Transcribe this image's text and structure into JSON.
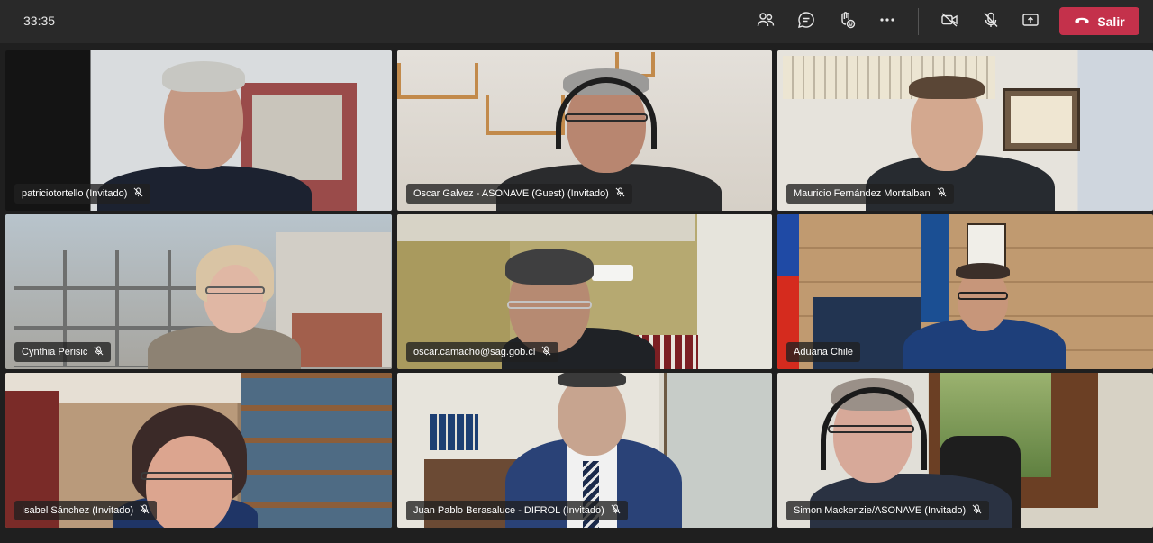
{
  "meeting": {
    "timer": "33:35",
    "leave_label": "Salir"
  },
  "controls": [
    {
      "name": "participants-icon"
    },
    {
      "name": "chat-icon"
    },
    {
      "name": "reactions-icon"
    },
    {
      "name": "more-options-icon"
    },
    {
      "name": "camera-off-icon"
    },
    {
      "name": "mic-muted-icon"
    },
    {
      "name": "share-screen-icon"
    }
  ],
  "participants": [
    {
      "name": "patriciotortello (Invitado)",
      "muted": true
    },
    {
      "name": "Oscar Galvez - ASONAVE (Guest) (Invitado)",
      "muted": true
    },
    {
      "name": "Mauricio Fernández Montalban",
      "muted": true
    },
    {
      "name": "Cynthia Perisic",
      "muted": true
    },
    {
      "name": "oscar.camacho@sag.gob.cl",
      "muted": true
    },
    {
      "name": "Aduana Chile",
      "muted": false
    },
    {
      "name": "Isabel Sánchez (Invitado)",
      "muted": true
    },
    {
      "name": "Juan Pablo Berasaluce - DIFROL (Invitado)",
      "muted": true
    },
    {
      "name": "Simon Mackenzie/ASONAVE (Invitado)",
      "muted": true
    }
  ],
  "colors": {
    "leave": "#c4314b",
    "topbar": "#292929",
    "background": "#1f1f1f"
  }
}
